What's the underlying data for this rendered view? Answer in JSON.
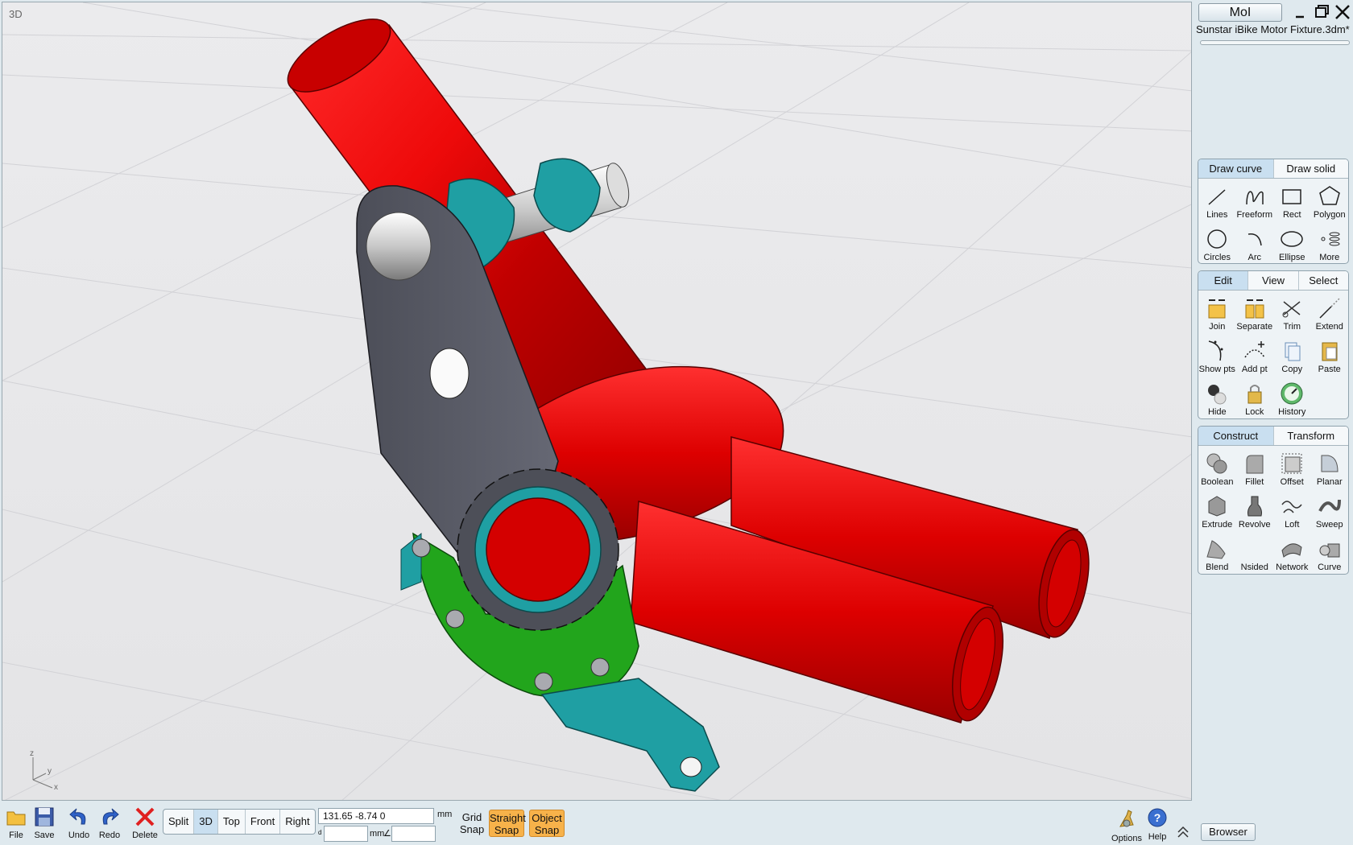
{
  "viewport": {
    "label": "3D",
    "axis": {
      "z": "z",
      "y": "y",
      "x": "x"
    }
  },
  "header": {
    "app_button": "MoI",
    "file_name": "Sunstar iBike Motor Fixture.3dm*"
  },
  "draw_panel": {
    "tabs": [
      "Draw curve",
      "Draw solid"
    ],
    "active_tab": "Draw curve",
    "buttons": [
      "Lines",
      "Freeform",
      "Rect",
      "Polygon",
      "Circles",
      "Arc",
      "Ellipse",
      "More"
    ]
  },
  "edit_panel": {
    "tabs": [
      "Edit",
      "View",
      "Select"
    ],
    "active_tab": "Edit",
    "buttons": [
      "Join",
      "Separate",
      "Trim",
      "Extend",
      "Show pts",
      "Add pt",
      "Copy",
      "Paste",
      "Hide",
      "Lock",
      "History"
    ]
  },
  "construct_panel": {
    "tabs": [
      "Construct",
      "Transform"
    ],
    "active_tab": "Construct",
    "buttons": [
      "Boolean",
      "Fillet",
      "Offset",
      "Planar",
      "Extrude",
      "Revolve",
      "Loft",
      "Sweep",
      "Blend",
      "Nsided",
      "Network",
      "Curve"
    ]
  },
  "bottom_bar": {
    "file": "File",
    "save": "Save",
    "undo": "Undo",
    "redo": "Redo",
    "delete": "Delete",
    "views": [
      "Split",
      "3D",
      "Top",
      "Front",
      "Right"
    ],
    "active_view": "3D",
    "coords": "131.65   -8.74    0",
    "unit": "mm",
    "dist_unit": "mm",
    "d_label": "d",
    "angle_symbol": "∠",
    "grid_snap": "Grid\nSnap",
    "straight_snap": "Straight Snap",
    "object_snap": "Object Snap",
    "options": "Options",
    "help": "Help",
    "browser": "Browser"
  },
  "colors": {
    "accent_tab": "#c9dff0",
    "snap_on": "#f7b24a",
    "frame_red": "#d40000",
    "plate_gray": "#5a5c66",
    "bracket_teal": "#1f9fa3",
    "ring_green": "#22a51c"
  }
}
